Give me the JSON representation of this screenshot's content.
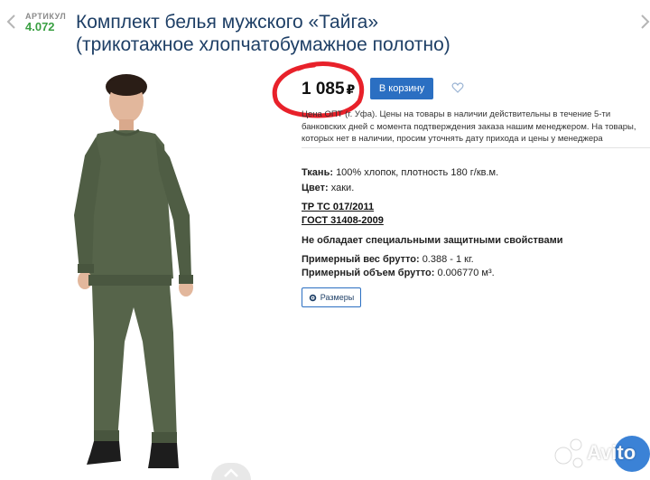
{
  "sku": {
    "label": "АРТИКУЛ",
    "value": "4.072"
  },
  "product": {
    "title_line1": "Комплект белья мужского «Тайга»",
    "title_line2": "(трикотажное хлопчатобумажное полотно)"
  },
  "price": {
    "amount": "1 085",
    "currency": "₽"
  },
  "actions": {
    "cart_label": "В корзину",
    "sizes_label": "Размеры"
  },
  "price_note": {
    "line1": "Цена ОПТ (г. Уфа). Цены на товары в наличии действительны в течение 5-ти",
    "line2": "банковских дней с момента подтверждения заказа нашим менеджером. На товары,",
    "line3": "которых нет в наличии, просим уточнять дату прихода и цены у менеджера"
  },
  "specs": {
    "fabric_label": "Ткань:",
    "fabric_value": "100% хлопок, плотность 180 г/кв.м.",
    "color_label": "Цвет:",
    "color_value": "хаки.",
    "standard_1": "ТР ТС 017/2011",
    "standard_2": "ГОСТ 31408-2009",
    "protection": "Не обладает специальными защитными свойствами",
    "weight_label": "Примерный вес брутто:",
    "weight_value": "0.388 - 1 кг.",
    "volume_label": "Примерный объем брутто:",
    "volume_value": "0.006770 м³."
  },
  "watermark": {
    "text": "Avito"
  },
  "colors": {
    "title": "#1e3f66",
    "sku": "#3aa043",
    "accent": "#2b6fc2",
    "marker": "#e8212a",
    "garment": "#56644a"
  },
  "icons": [
    "chevron-left-icon",
    "chevron-right-icon",
    "heart-icon",
    "gear-icon",
    "chevron-up-icon",
    "avito-logo"
  ]
}
